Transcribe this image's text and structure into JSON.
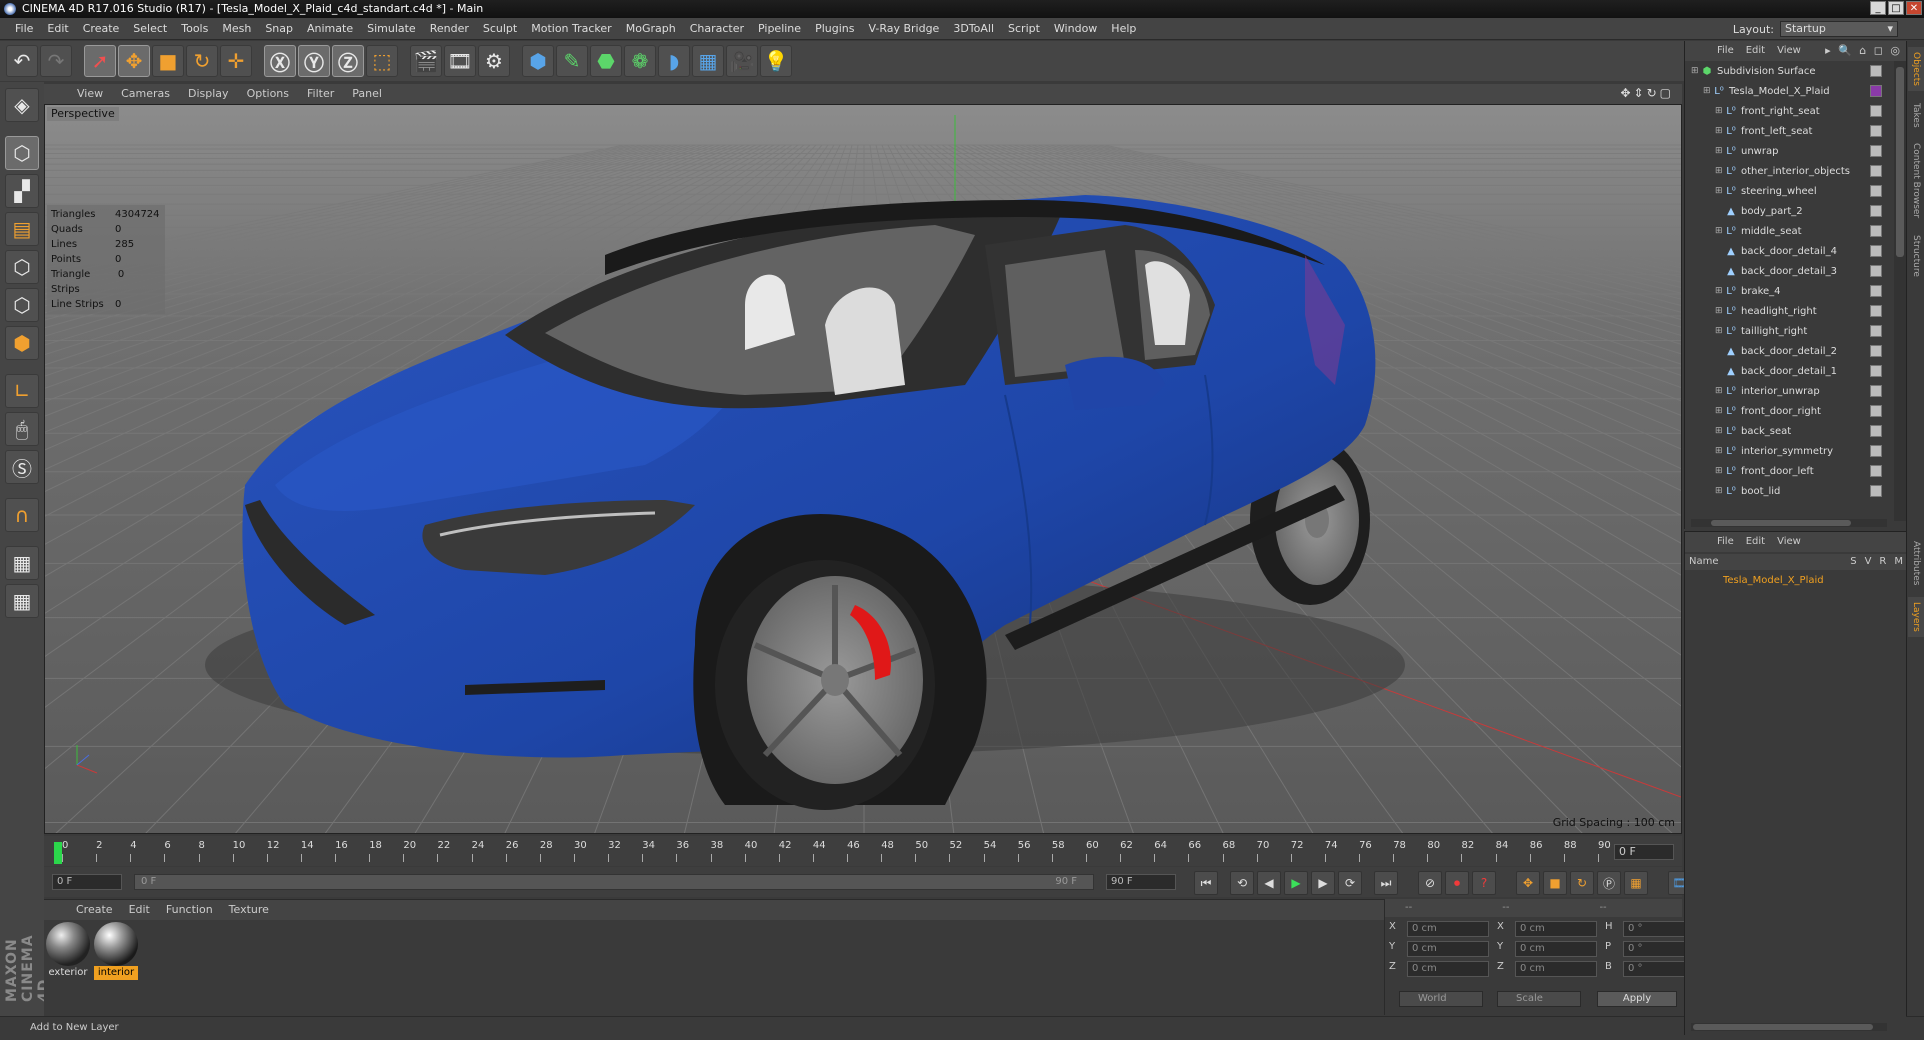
{
  "window": {
    "title": "CINEMA 4D R17.016 Studio (R17) - [Tesla_Model_X_Plaid_c4d_standart.c4d *] - Main"
  },
  "menu": [
    "File",
    "Edit",
    "Create",
    "Select",
    "Tools",
    "Mesh",
    "Snap",
    "Animate",
    "Simulate",
    "Render",
    "Sculpt",
    "Motion Tracker",
    "MoGraph",
    "Character",
    "Pipeline",
    "Plugins",
    "V-Ray Bridge",
    "3DToAll",
    "Script",
    "Window",
    "Help"
  ],
  "layout": {
    "label": "Layout:",
    "value": "Startup"
  },
  "viewport": {
    "menu": [
      "View",
      "Cameras",
      "Display",
      "Options",
      "Filter",
      "Panel"
    ],
    "label": "Perspective",
    "grid_spacing": "Grid Spacing : 100 cm",
    "stats": [
      {
        "k": "Triangles",
        "v": "4304724"
      },
      {
        "k": "Quads",
        "v": "0"
      },
      {
        "k": "Lines",
        "v": "285"
      },
      {
        "k": "Points",
        "v": "0"
      },
      {
        "k": "Triangle Strips",
        "v": "0"
      },
      {
        "k": "Line Strips",
        "v": "0"
      }
    ]
  },
  "timeline": {
    "ticks": [
      "0",
      "2",
      "4",
      "6",
      "8",
      "10",
      "12",
      "14",
      "16",
      "18",
      "20",
      "22",
      "24",
      "26",
      "28",
      "30",
      "32",
      "34",
      "36",
      "38",
      "40",
      "42",
      "44",
      "46",
      "48",
      "50",
      "52",
      "54",
      "56",
      "58",
      "60",
      "62",
      "64",
      "66",
      "68",
      "70",
      "72",
      "74",
      "76",
      "78",
      "80",
      "82",
      "84",
      "86",
      "88",
      "90"
    ],
    "current_frame": "0 F",
    "start": "0 F",
    "range_start": "0 F",
    "range_end": "90 F",
    "end": "90 F"
  },
  "materials": {
    "menu": [
      "Create",
      "Edit",
      "Function",
      "Texture"
    ],
    "items": [
      {
        "label": "exterior",
        "selected": false
      },
      {
        "label": "interior",
        "selected": true
      }
    ]
  },
  "coords": {
    "header": [
      "--",
      "--",
      "--"
    ],
    "rows": [
      {
        "a": "X",
        "av": "0 cm",
        "b": "X",
        "bv": "0 cm",
        "c": "H",
        "cv": "0 °"
      },
      {
        "a": "Y",
        "av": "0 cm",
        "b": "Y",
        "bv": "0 cm",
        "c": "P",
        "cv": "0 °"
      },
      {
        "a": "Z",
        "av": "0 cm",
        "b": "Z",
        "bv": "0 cm",
        "c": "B",
        "cv": "0 °"
      }
    ],
    "mode1": "World",
    "mode2": "Scale",
    "apply": "Apply"
  },
  "objects": {
    "menu": [
      "File",
      "Edit",
      "View"
    ],
    "items": [
      {
        "name": "Subdivision Surface",
        "level": 0,
        "icon": "subdivision-icon"
      },
      {
        "name": "Tesla_Model_X_Plaid",
        "level": 1,
        "icon": "null-icon"
      },
      {
        "name": "front_right_seat",
        "level": 2,
        "icon": "null-icon"
      },
      {
        "name": "front_left_seat",
        "level": 2,
        "icon": "null-icon"
      },
      {
        "name": "unwrap",
        "level": 2,
        "icon": "null-icon"
      },
      {
        "name": "other_interior_objects",
        "level": 2,
        "icon": "null-icon"
      },
      {
        "name": "steering_wheel",
        "level": 2,
        "icon": "null-icon"
      },
      {
        "name": "body_part_2",
        "level": 2,
        "icon": "polygon-icon"
      },
      {
        "name": "middle_seat",
        "level": 2,
        "icon": "null-icon"
      },
      {
        "name": "back_door_detail_4",
        "level": 2,
        "icon": "polygon-icon"
      },
      {
        "name": "back_door_detail_3",
        "level": 2,
        "icon": "polygon-icon"
      },
      {
        "name": "brake_4",
        "level": 2,
        "icon": "null-icon"
      },
      {
        "name": "headlight_right",
        "level": 2,
        "icon": "null-icon"
      },
      {
        "name": "taillight_right",
        "level": 2,
        "icon": "null-icon"
      },
      {
        "name": "back_door_detail_2",
        "level": 2,
        "icon": "polygon-icon"
      },
      {
        "name": "back_door_detail_1",
        "level": 2,
        "icon": "polygon-icon"
      },
      {
        "name": "interior_unwrap",
        "level": 2,
        "icon": "null-icon"
      },
      {
        "name": "front_door_right",
        "level": 2,
        "icon": "null-icon"
      },
      {
        "name": "back_seat",
        "level": 2,
        "icon": "null-icon"
      },
      {
        "name": "interior_symmetry",
        "level": 2,
        "icon": "null-icon"
      },
      {
        "name": "front_door_left",
        "level": 2,
        "icon": "null-icon"
      },
      {
        "name": "boot_lid",
        "level": 2,
        "icon": "null-icon"
      }
    ]
  },
  "layers": {
    "menu": [
      "File",
      "Edit",
      "View"
    ],
    "col_name": "Name",
    "cols": [
      "S",
      "V",
      "R",
      "M"
    ],
    "row": "Tesla_Model_X_Plaid"
  },
  "right_tabs": [
    "Objects",
    "Takes",
    "Content Browser",
    "Structure",
    "Attributes",
    "Layers"
  ],
  "status": "Add to New Layer",
  "maxon": "MAXON CINEMA 4D",
  "colors": {
    "accent": "#f0a020",
    "car_body": "#1f47a8",
    "caliper": "#e01818"
  }
}
